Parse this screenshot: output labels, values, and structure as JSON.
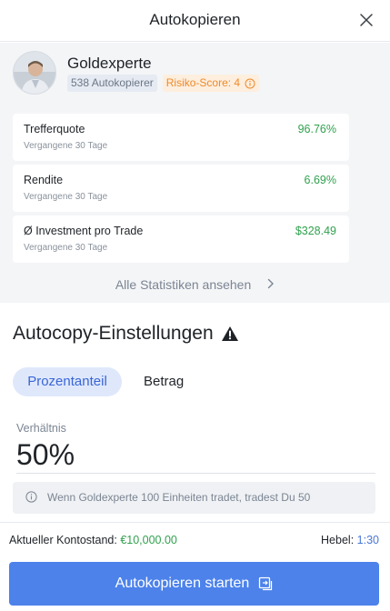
{
  "header": {
    "title": "Autokopieren",
    "close_icon": "close-icon"
  },
  "trader": {
    "name": "Goldexperte",
    "copiers": "538 Autokopierer",
    "risk_score": "Risiko-Score: 4",
    "avatar_icon": "avatar-photo"
  },
  "stats": [
    {
      "label": "Trefferquote",
      "sub": "Vergangene 30 Tage",
      "value": "96.76%"
    },
    {
      "label": "Rendite",
      "sub": "Vergangene 30 Tage",
      "value": "6.69%"
    },
    {
      "label": "Ø Investment pro Trade",
      "sub": "Vergangene 30 Tage",
      "value": "$328.49"
    }
  ],
  "all_stats_link": "Alle Statistiken ansehen",
  "settings": {
    "title": "Autocopy-Einstellungen",
    "tabs": [
      {
        "label": "Prozentanteil",
        "active": true
      },
      {
        "label": "Betrag",
        "active": false
      }
    ],
    "ratio_label": "Verhältnis",
    "ratio_value": "50%",
    "info_text": "Wenn Goldexperte 100 Einheiten tradet, tradest Du 50"
  },
  "footer": {
    "balance_label": "Aktueller Kontostand:",
    "balance_value": "€10,000.00",
    "leverage_label": "Hebel:",
    "leverage_value": "1:30",
    "start_button": "Autokopieren starten"
  },
  "colors": {
    "accent": "#4c82ea",
    "positive": "#30a14e",
    "risk": "#ef8a2a",
    "warning": "#1f2328"
  }
}
